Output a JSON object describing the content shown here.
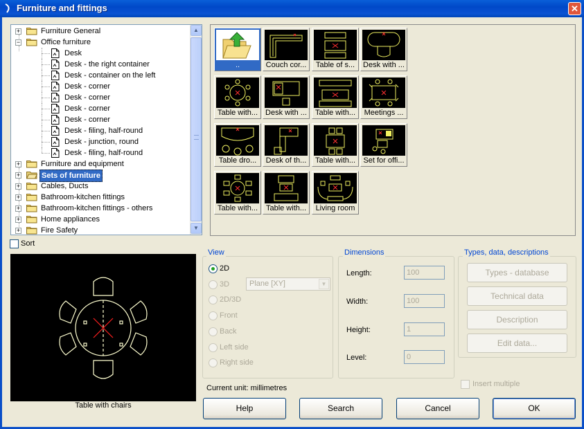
{
  "window": {
    "title": "Furniture and fittings",
    "close_glyph": "✕"
  },
  "tree": {
    "items": [
      {
        "label": "Furniture General",
        "type": "folder",
        "expander": "+",
        "level": 0
      },
      {
        "label": "Office furniture",
        "type": "folder",
        "expander": "−",
        "level": 0
      },
      {
        "label": "Desk",
        "type": "doc",
        "level": 1
      },
      {
        "label": "Desk - the right container",
        "type": "doc",
        "level": 1
      },
      {
        "label": "Desk - container on the left",
        "type": "doc",
        "level": 1
      },
      {
        "label": "Desk - corner",
        "type": "doc",
        "level": 1
      },
      {
        "label": "Desk - corner",
        "type": "doc",
        "level": 1
      },
      {
        "label": "Desk - corner",
        "type": "doc",
        "level": 1
      },
      {
        "label": "Desk - corner",
        "type": "doc",
        "level": 1
      },
      {
        "label": "Desk - filing, half-round",
        "type": "doc",
        "level": 1
      },
      {
        "label": "Desk - junction, round",
        "type": "doc",
        "level": 1
      },
      {
        "label": "Desk - filing, half-round",
        "type": "doc",
        "level": 1
      },
      {
        "label": "Furniture and equipment",
        "type": "folder",
        "expander": "+",
        "level": 0
      },
      {
        "label": "Sets of furniture",
        "type": "folder-open",
        "expander": "+",
        "level": 0,
        "selected": true
      },
      {
        "label": "Cables, Ducts",
        "type": "folder",
        "expander": "+",
        "level": 0
      },
      {
        "label": "Bathroom-kitchen fittings",
        "type": "folder",
        "expander": "+",
        "level": 0
      },
      {
        "label": "Bathroom-kitchen fittings - others",
        "type": "folder",
        "expander": "+",
        "level": 0
      },
      {
        "label": "Home appliances",
        "type": "folder",
        "expander": "+",
        "level": 0
      },
      {
        "label": "Fire Safety",
        "type": "folder",
        "expander": "+",
        "level": 0
      }
    ]
  },
  "sort": {
    "label": "Sort",
    "checked": false
  },
  "tiles": [
    {
      "caption": "..",
      "selected": true,
      "icon": "folder-up-icon"
    },
    {
      "caption": "Couch cor...",
      "icon": "couch-corner-icon"
    },
    {
      "caption": "Table of s...",
      "icon": "table-set-icon"
    },
    {
      "caption": "Desk with ...",
      "icon": "desk-with-icon"
    },
    {
      "caption": "Table with...",
      "icon": "round-table-chairs-icon"
    },
    {
      "caption": "Desk with ...",
      "icon": "desk-chair-icon"
    },
    {
      "caption": "Table with...",
      "icon": "table-sofa-icon"
    },
    {
      "caption": "Meetings ...",
      "icon": "meeting-table-icon"
    },
    {
      "caption": "Table dro...",
      "icon": "table-drop-icon"
    },
    {
      "caption": "Desk of th...",
      "icon": "desk-of-the-icon"
    },
    {
      "caption": "Table with...",
      "icon": "table-two-chairs-icon"
    },
    {
      "caption": "Set for offi...",
      "icon": "office-set-icon"
    },
    {
      "caption": "Table with...",
      "icon": "round-table-small-icon"
    },
    {
      "caption": "Table with...",
      "icon": "desk-tv-icon"
    },
    {
      "caption": "Living room",
      "icon": "living-room-icon"
    }
  ],
  "preview": {
    "caption": "Table with chairs"
  },
  "view": {
    "title": "View",
    "options": [
      {
        "label": "2D",
        "checked": true,
        "enabled": true
      },
      {
        "label": "3D",
        "checked": false,
        "enabled": false
      },
      {
        "label": "2D/3D",
        "checked": false,
        "enabled": false
      },
      {
        "label": "Front",
        "checked": false,
        "enabled": false
      },
      {
        "label": "Back",
        "checked": false,
        "enabled": false
      },
      {
        "label": "Left side",
        "checked": false,
        "enabled": false
      },
      {
        "label": "Right side",
        "checked": false,
        "enabled": false
      }
    ],
    "plane_value": "Plane [XY]",
    "current_unit": "Current unit: millimetres"
  },
  "dimensions": {
    "title": "Dimensions",
    "length_label": "Length:",
    "length_value": "100",
    "width_label": "Width:",
    "width_value": "100",
    "height_label": "Height:",
    "height_value": "1",
    "level_label": "Level:",
    "level_value": "0"
  },
  "types": {
    "title": "Types, data, descriptions",
    "types_database": "Types - database",
    "technical_data": "Technical data",
    "description": "Description",
    "edit_data": "Edit data..."
  },
  "insert_multiple": {
    "label": "Insert multiple",
    "checked": false
  },
  "buttons": {
    "help": "Help",
    "search": "Search",
    "cancel": "Cancel",
    "ok": "OK"
  }
}
